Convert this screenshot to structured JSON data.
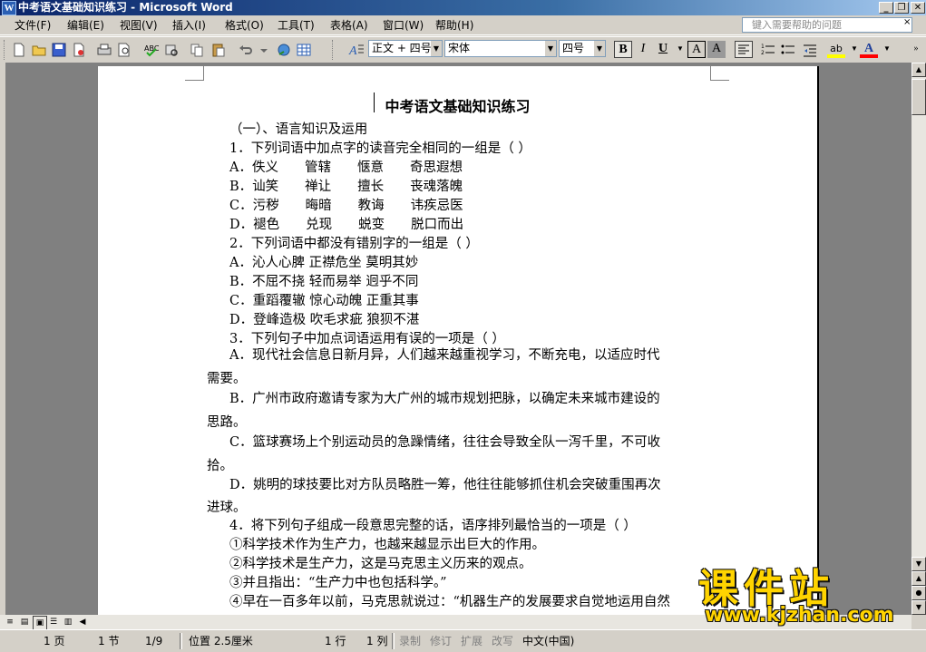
{
  "window": {
    "title": "中考语文基础知识练习 - Microsoft Word",
    "icon_letter": "W",
    "controls": [
      "_",
      "❐",
      "✕"
    ]
  },
  "menubar": {
    "items": [
      "文件(F)",
      "编辑(E)",
      "视图(V)",
      "插入(I)",
      "格式(O)",
      "工具(T)",
      "表格(A)",
      "窗口(W)",
      "帮助(H)"
    ],
    "help_placeholder": "键入需要帮助的问题",
    "close_doc": "×"
  },
  "toolbar": {
    "style_value": "正文 + 四号",
    "font_value": "宋体",
    "size_value": "四号",
    "bold": "B",
    "italic": "I",
    "underline": "U",
    "char_border": "A",
    "char_shading": "A",
    "font_color": "A",
    "highlight": "ab"
  },
  "document": {
    "title": "中考语文基础知识练习",
    "lines": [
      "（一）、语言知识及运用",
      "1．下列词语中加点字的读音完全相同的一组是（  ）",
      "A．佚义　　管辖　　惬意　　奇思遐想",
      "B．讪笑　　禅让　　擅长　　丧魂落魄",
      "C．污秽　　晦暗　　教诲　　讳疾忌医",
      "D．褪色　　兑现　　蜕变　　脱口而出",
      "2．下列词语中都没有错别字的一组是（  ）",
      "A．沁人心脾 正襟危坐 莫明其妙",
      "B．不屈不挠 轻而易举 迥乎不同",
      "C．重蹈覆辙 惊心动魄 正重其事",
      "D．登峰造极 吹毛求疵 狼狈不湛",
      "3．下列句子中加点词语运用有误的一项是（  ）",
      "A．现代社会信息日新月异，人们越来越重视学习，不断充电，以适应时代",
      "需要。",
      "B．广州市政府邀请专家为大广州的城市规划把脉，以确定未来城市建设的",
      "思路。",
      "C．篮球赛场上个别运动员的急躁情绪，往往会导致全队一泻千里，不可收",
      "拾。",
      "D．姚明的球技要比对方队员略胜一筹，他往往能够抓住机会突破重围再次",
      "进球。",
      "4．将下列句子组成一段意思完整的话，语序排列最恰当的一项是（  ）",
      "①科学技术作为生产力，也越来越显示出巨大的作用。",
      "②科学技术是生产力，这是马克思主义历来的观点。",
      "③并且指出：“生产力中也包括科学。”",
      "④早在一百多年以前，马克思就说过：“机器生产的发展要求自觉地运用自然"
    ]
  },
  "statusbar": {
    "page": "1 页",
    "section": "1 节",
    "page_of": "1/9",
    "position": "位置 2.5厘米",
    "line": "1 行",
    "col": "1 列",
    "rec": "录制",
    "trk": "修订",
    "ext": "扩展",
    "ovr": "改写",
    "language": "中文(中国)"
  },
  "watermark": {
    "cn": "课件站",
    "url": "www.kjzhan.com"
  }
}
